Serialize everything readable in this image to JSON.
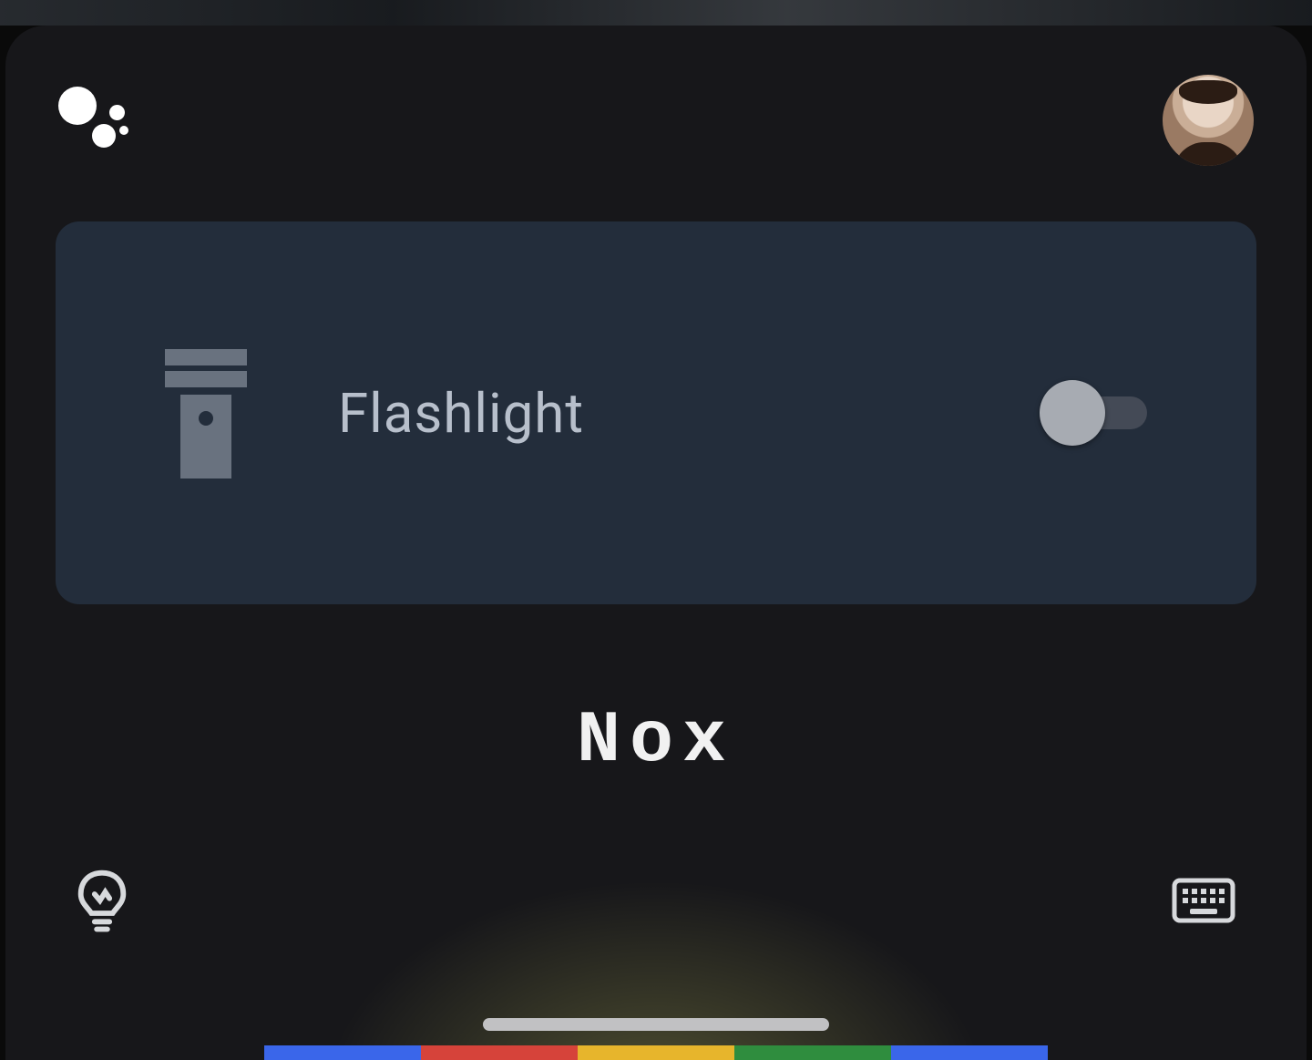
{
  "card": {
    "label": "Flashlight",
    "toggle_on": false
  },
  "voice": {
    "transcript": "Nox"
  },
  "colors": {
    "panel_bg": "#17171a",
    "card_bg": "#232d3b",
    "text_muted": "#b7bfcb",
    "rainbow": [
      "#3a66ea",
      "#d6433a",
      "#e7b52c",
      "#2f8d3e",
      "#3a66ea"
    ]
  },
  "icons": {
    "assistant": "assistant-logo",
    "flashlight": "flashlight-icon",
    "lightbulb": "lightbulb-icon",
    "keyboard": "keyboard-icon"
  }
}
